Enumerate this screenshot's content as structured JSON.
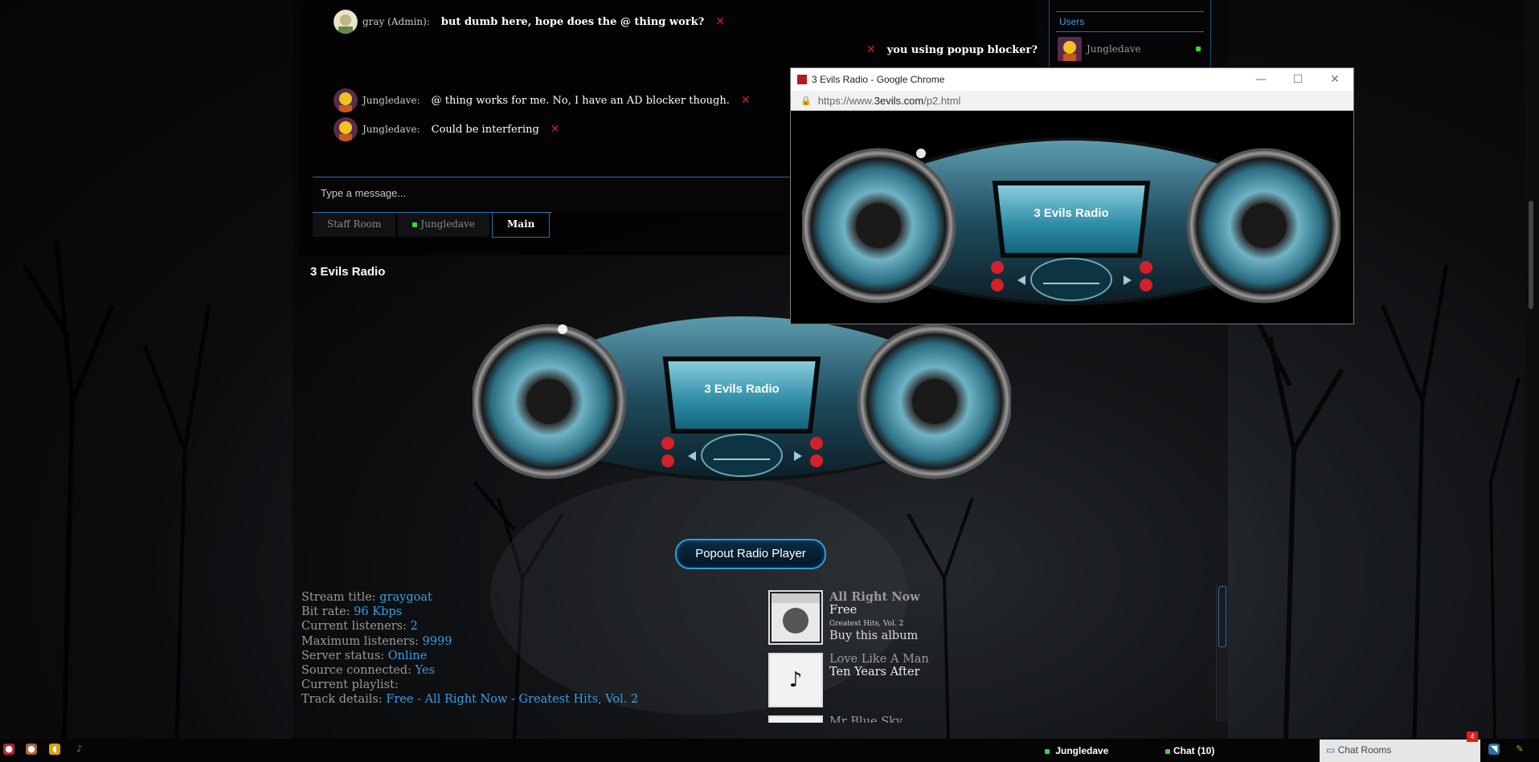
{
  "chat": {
    "messages": [
      {
        "user": "gray (Admin):",
        "text": "but dumb here, hope does the @ thing work?"
      },
      {
        "user": "",
        "text": "you using popup blocker?"
      },
      {
        "user": "Jungledave:",
        "text": "@ thing works for me. No, I have an AD blocker though."
      },
      {
        "user": "Jungledave:",
        "text": "Could be interfering"
      }
    ],
    "input_placeholder": "Type a message...",
    "tabs": [
      "Staff Room",
      "Jungledave",
      "Main"
    ]
  },
  "sidebar": {
    "users_label": "Users",
    "users": [
      {
        "name": "Jungledave",
        "status": "online"
      }
    ]
  },
  "radio": {
    "section_title": "3 Evils Radio",
    "player_title": "3 Evils Radio",
    "popout_label": "Popout Radio Player"
  },
  "stats": [
    {
      "label": "Stream title:",
      "value": "graygoat"
    },
    {
      "label": "Bit rate:",
      "value": "96 Kbps"
    },
    {
      "label": "Current listeners:",
      "value": "2"
    },
    {
      "label": "Maximum listeners:",
      "value": "9999"
    },
    {
      "label": "Server status:",
      "value": "Online"
    },
    {
      "label": "Source connected:",
      "value": "Yes"
    },
    {
      "label": "Current playlist:",
      "value": ""
    },
    {
      "label": "Track details:",
      "value": "Free - All Right Now - Greatest Hits, Vol. 2"
    }
  ],
  "tracks": [
    {
      "title": "All Right Now",
      "artist": "Free",
      "album": "Greatest Hits, Vol. 2",
      "buy": "Buy this album"
    },
    {
      "title": "Love Like A Man",
      "artist": "Ten Years After"
    },
    {
      "title": "Mr Blue Sky"
    }
  ],
  "popup": {
    "window_title": "3 Evils Radio - Google Chrome",
    "url_prefix": "https://www.",
    "url_domain": "3evils.com",
    "url_path": "/p2.html",
    "player_title": "3 Evils Radio"
  },
  "taskbar": {
    "user": "Jungledave",
    "chat": "Chat (10)",
    "chat_rooms": "Chat Rooms",
    "badge": "4"
  },
  "colors": {
    "accent": "#2d6fa8",
    "link": "#3a9ee6",
    "online": "#3cd43c",
    "close_x": "#d02020"
  }
}
